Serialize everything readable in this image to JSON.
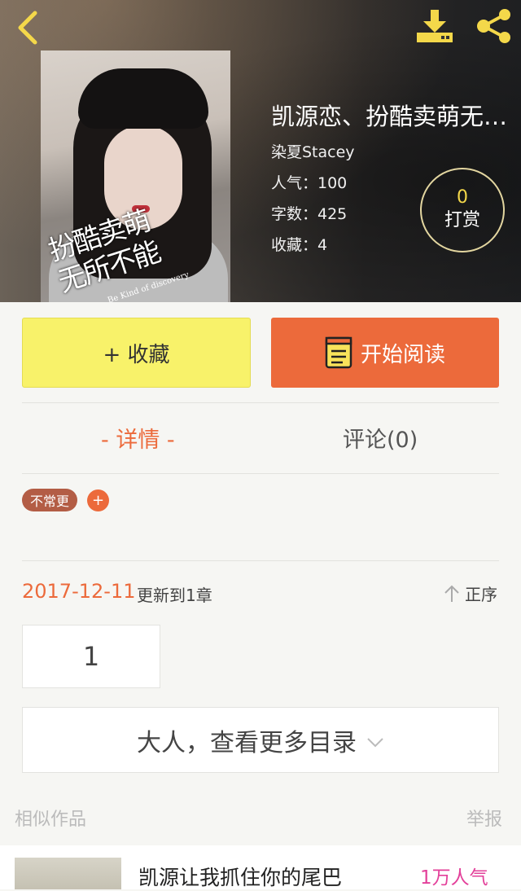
{
  "book": {
    "title": "凯源恋、扮酷卖萌无…",
    "author": "染夏Stacey",
    "popularity": "人气：100",
    "word_count": "字数：425",
    "favorites": "收藏：4",
    "cover_text_1": "扮酷卖萌",
    "cover_text_2": "无所不能",
    "cover_subtitle": "Be Kind of discovery"
  },
  "tip": {
    "count": "0",
    "label": "打赏"
  },
  "actions": {
    "collect_label": "+ 收藏",
    "read_label": "开始阅读"
  },
  "tabs": {
    "detail": "- 详情 -",
    "comments": "评论(0)"
  },
  "tags": {
    "badge": "不常更",
    "add": "+"
  },
  "update": {
    "date": "2017-12-11",
    "info": "更新到1章",
    "sort_label": "正序"
  },
  "chapters": {
    "first": "1",
    "more_label": "大人，查看更多目录"
  },
  "similar": {
    "heading": "相似作品",
    "report": "举报",
    "items": [
      {
        "title": "凯源让我抓住你的尾巴",
        "popularity": "1万人气"
      }
    ]
  },
  "colors": {
    "accent": "#ec6a3b",
    "collect_bg": "#f8f26a",
    "tip_gold": "#f4d84a",
    "pink": "#e3409a"
  }
}
